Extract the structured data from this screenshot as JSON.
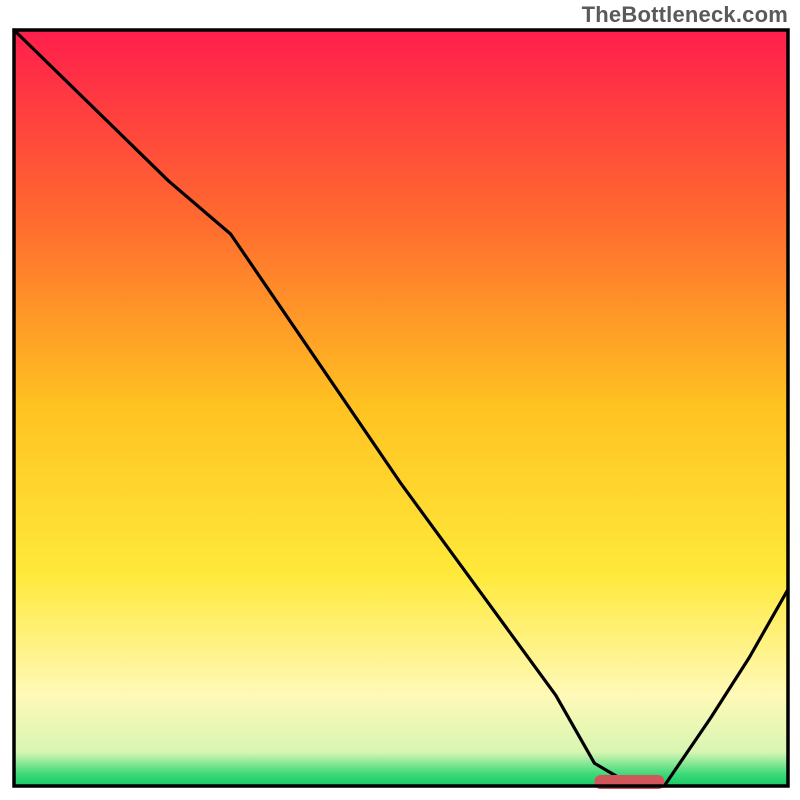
{
  "watermark": "TheBottleneck.com",
  "chart_data": {
    "type": "line",
    "title": "",
    "xlabel": "",
    "ylabel": "",
    "xlim": [
      0,
      100
    ],
    "ylim": [
      0,
      100
    ],
    "grid": false,
    "legend": false,
    "background_gradient": {
      "stops": [
        {
          "offset": 0.0,
          "color": "#ff1e4c"
        },
        {
          "offset": 0.25,
          "color": "#ff6a2f"
        },
        {
          "offset": 0.5,
          "color": "#ffc321"
        },
        {
          "offset": 0.72,
          "color": "#ffe93b"
        },
        {
          "offset": 0.88,
          "color": "#fff9b8"
        },
        {
          "offset": 0.955,
          "color": "#d8f6b2"
        },
        {
          "offset": 0.985,
          "color": "#39d978"
        },
        {
          "offset": 1.0,
          "color": "#17c964"
        }
      ]
    },
    "optimal_zone": {
      "x_start": 75,
      "x_end": 84,
      "y": 0
    },
    "x": [
      0,
      10,
      20,
      28,
      40,
      50,
      60,
      70,
      75,
      80,
      84,
      90,
      95,
      100
    ],
    "values": [
      100,
      90,
      80,
      73,
      55,
      40,
      26,
      12,
      3,
      0,
      0,
      9,
      17,
      26
    ]
  }
}
